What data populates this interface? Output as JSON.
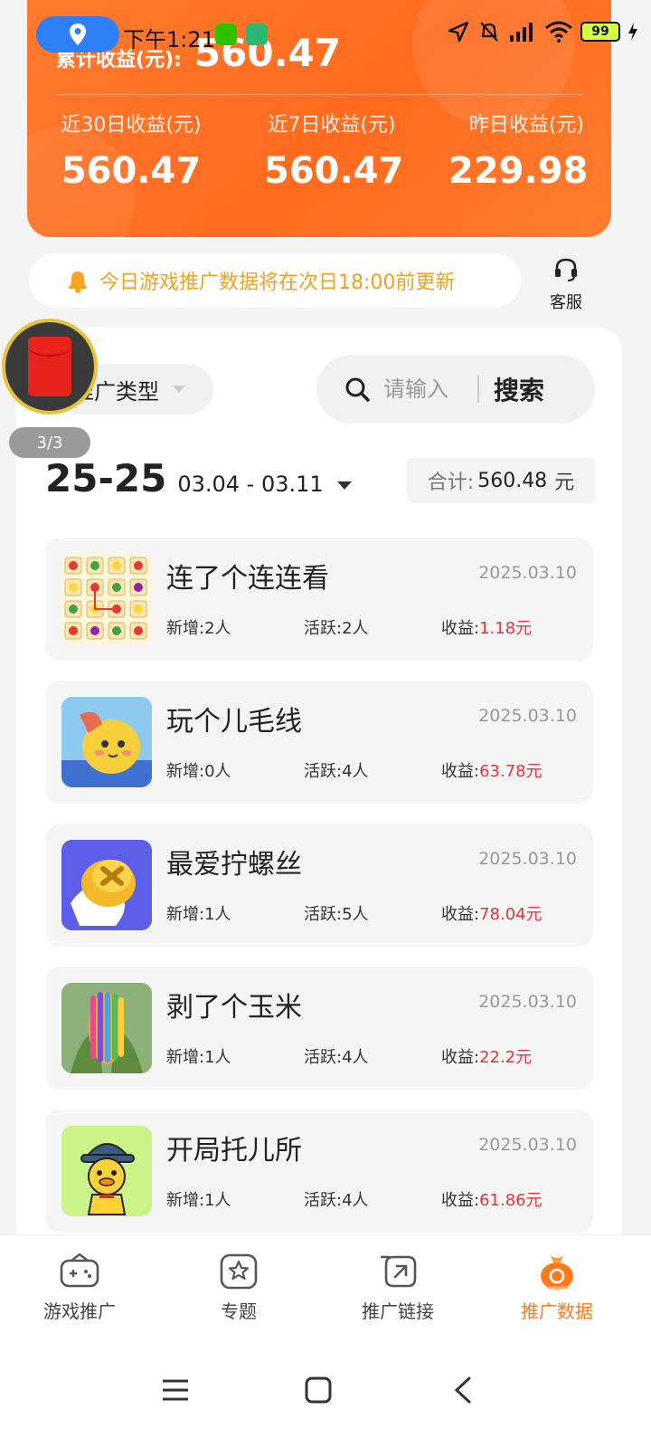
{
  "status_bar": {
    "time": "下午1:21",
    "battery": "99"
  },
  "summary": {
    "total_label": "累计收益(元):",
    "total_value": "560.47",
    "periods": [
      {
        "label": "近30日收益(元)",
        "value": "560.47"
      },
      {
        "label": "近7日收益(元)",
        "value": "560.47"
      },
      {
        "label": "昨日收益(元)",
        "value": "229.98"
      }
    ]
  },
  "notice": {
    "text": "今日游戏推广数据将在次日18:00前更新"
  },
  "customer_service": {
    "label": "客服"
  },
  "filter": {
    "type_label": "推广类型"
  },
  "search": {
    "placeholder": "请输入",
    "button_label": "搜索"
  },
  "floating": {
    "page_indicator": "3/3"
  },
  "date_filter": {
    "week": "25-25",
    "range": "03.04 - 03.11"
  },
  "total": {
    "label": "合计:",
    "value": "560.48",
    "unit": "元"
  },
  "games": [
    {
      "name": "连了个连连看",
      "date": "2025.03.10",
      "new": "新增:2人",
      "active": "活跃:2人",
      "earn_label": "收益:",
      "earn_value": "1.18元"
    },
    {
      "name": "玩个儿毛线",
      "date": "2025.03.10",
      "new": "新增:0人",
      "active": "活跃:4人",
      "earn_label": "收益:",
      "earn_value": "63.78元"
    },
    {
      "name": "最爱拧螺丝",
      "date": "2025.03.10",
      "new": "新增:1人",
      "active": "活跃:5人",
      "earn_label": "收益:",
      "earn_value": "78.04元"
    },
    {
      "name": "剥了个玉米",
      "date": "2025.03.10",
      "new": "新增:1人",
      "active": "活跃:4人",
      "earn_label": "收益:",
      "earn_value": "22.2元"
    },
    {
      "name": "开局托儿所",
      "date": "2025.03.10",
      "new": "新增:1人",
      "active": "活跃:4人",
      "earn_label": "收益:",
      "earn_value": "61.86元"
    }
  ],
  "tabs": [
    {
      "label": "游戏推广",
      "icon": "gamepad-icon"
    },
    {
      "label": "专题",
      "icon": "star-badge-icon"
    },
    {
      "label": "推广链接",
      "icon": "link-icon"
    },
    {
      "label": "推广数据",
      "icon": "money-bag-icon"
    }
  ],
  "colors": {
    "accent": "#ff7a1a",
    "earn": "#e5323c",
    "notice": "#f2a020"
  }
}
